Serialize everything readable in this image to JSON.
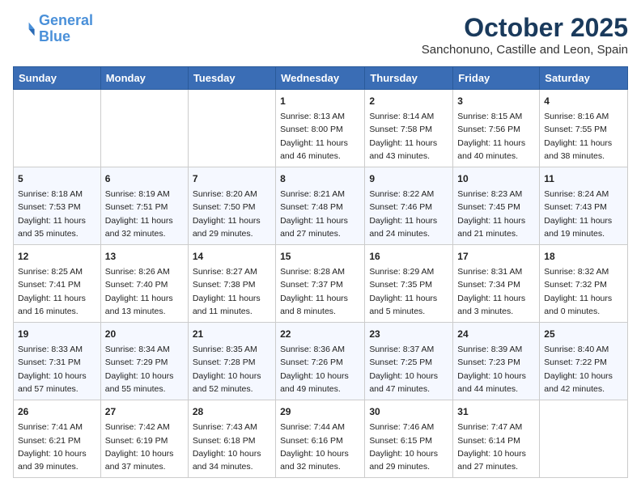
{
  "header": {
    "logo_line1": "General",
    "logo_line2": "Blue",
    "month": "October 2025",
    "location": "Sanchonuno, Castille and Leon, Spain"
  },
  "weekdays": [
    "Sunday",
    "Monday",
    "Tuesday",
    "Wednesday",
    "Thursday",
    "Friday",
    "Saturday"
  ],
  "weeks": [
    [
      {
        "day": "",
        "info": ""
      },
      {
        "day": "",
        "info": ""
      },
      {
        "day": "",
        "info": ""
      },
      {
        "day": "1",
        "info": "Sunrise: 8:13 AM\nSunset: 8:00 PM\nDaylight: 11 hours\nand 46 minutes."
      },
      {
        "day": "2",
        "info": "Sunrise: 8:14 AM\nSunset: 7:58 PM\nDaylight: 11 hours\nand 43 minutes."
      },
      {
        "day": "3",
        "info": "Sunrise: 8:15 AM\nSunset: 7:56 PM\nDaylight: 11 hours\nand 40 minutes."
      },
      {
        "day": "4",
        "info": "Sunrise: 8:16 AM\nSunset: 7:55 PM\nDaylight: 11 hours\nand 38 minutes."
      }
    ],
    [
      {
        "day": "5",
        "info": "Sunrise: 8:18 AM\nSunset: 7:53 PM\nDaylight: 11 hours\nand 35 minutes."
      },
      {
        "day": "6",
        "info": "Sunrise: 8:19 AM\nSunset: 7:51 PM\nDaylight: 11 hours\nand 32 minutes."
      },
      {
        "day": "7",
        "info": "Sunrise: 8:20 AM\nSunset: 7:50 PM\nDaylight: 11 hours\nand 29 minutes."
      },
      {
        "day": "8",
        "info": "Sunrise: 8:21 AM\nSunset: 7:48 PM\nDaylight: 11 hours\nand 27 minutes."
      },
      {
        "day": "9",
        "info": "Sunrise: 8:22 AM\nSunset: 7:46 PM\nDaylight: 11 hours\nand 24 minutes."
      },
      {
        "day": "10",
        "info": "Sunrise: 8:23 AM\nSunset: 7:45 PM\nDaylight: 11 hours\nand 21 minutes."
      },
      {
        "day": "11",
        "info": "Sunrise: 8:24 AM\nSunset: 7:43 PM\nDaylight: 11 hours\nand 19 minutes."
      }
    ],
    [
      {
        "day": "12",
        "info": "Sunrise: 8:25 AM\nSunset: 7:41 PM\nDaylight: 11 hours\nand 16 minutes."
      },
      {
        "day": "13",
        "info": "Sunrise: 8:26 AM\nSunset: 7:40 PM\nDaylight: 11 hours\nand 13 minutes."
      },
      {
        "day": "14",
        "info": "Sunrise: 8:27 AM\nSunset: 7:38 PM\nDaylight: 11 hours\nand 11 minutes."
      },
      {
        "day": "15",
        "info": "Sunrise: 8:28 AM\nSunset: 7:37 PM\nDaylight: 11 hours\nand 8 minutes."
      },
      {
        "day": "16",
        "info": "Sunrise: 8:29 AM\nSunset: 7:35 PM\nDaylight: 11 hours\nand 5 minutes."
      },
      {
        "day": "17",
        "info": "Sunrise: 8:31 AM\nSunset: 7:34 PM\nDaylight: 11 hours\nand 3 minutes."
      },
      {
        "day": "18",
        "info": "Sunrise: 8:32 AM\nSunset: 7:32 PM\nDaylight: 11 hours\nand 0 minutes."
      }
    ],
    [
      {
        "day": "19",
        "info": "Sunrise: 8:33 AM\nSunset: 7:31 PM\nDaylight: 10 hours\nand 57 minutes."
      },
      {
        "day": "20",
        "info": "Sunrise: 8:34 AM\nSunset: 7:29 PM\nDaylight: 10 hours\nand 55 minutes."
      },
      {
        "day": "21",
        "info": "Sunrise: 8:35 AM\nSunset: 7:28 PM\nDaylight: 10 hours\nand 52 minutes."
      },
      {
        "day": "22",
        "info": "Sunrise: 8:36 AM\nSunset: 7:26 PM\nDaylight: 10 hours\nand 49 minutes."
      },
      {
        "day": "23",
        "info": "Sunrise: 8:37 AM\nSunset: 7:25 PM\nDaylight: 10 hours\nand 47 minutes."
      },
      {
        "day": "24",
        "info": "Sunrise: 8:39 AM\nSunset: 7:23 PM\nDaylight: 10 hours\nand 44 minutes."
      },
      {
        "day": "25",
        "info": "Sunrise: 8:40 AM\nSunset: 7:22 PM\nDaylight: 10 hours\nand 42 minutes."
      }
    ],
    [
      {
        "day": "26",
        "info": "Sunrise: 7:41 AM\nSunset: 6:21 PM\nDaylight: 10 hours\nand 39 minutes."
      },
      {
        "day": "27",
        "info": "Sunrise: 7:42 AM\nSunset: 6:19 PM\nDaylight: 10 hours\nand 37 minutes."
      },
      {
        "day": "28",
        "info": "Sunrise: 7:43 AM\nSunset: 6:18 PM\nDaylight: 10 hours\nand 34 minutes."
      },
      {
        "day": "29",
        "info": "Sunrise: 7:44 AM\nSunset: 6:16 PM\nDaylight: 10 hours\nand 32 minutes."
      },
      {
        "day": "30",
        "info": "Sunrise: 7:46 AM\nSunset: 6:15 PM\nDaylight: 10 hours\nand 29 minutes."
      },
      {
        "day": "31",
        "info": "Sunrise: 7:47 AM\nSunset: 6:14 PM\nDaylight: 10 hours\nand 27 minutes."
      },
      {
        "day": "",
        "info": ""
      }
    ]
  ]
}
